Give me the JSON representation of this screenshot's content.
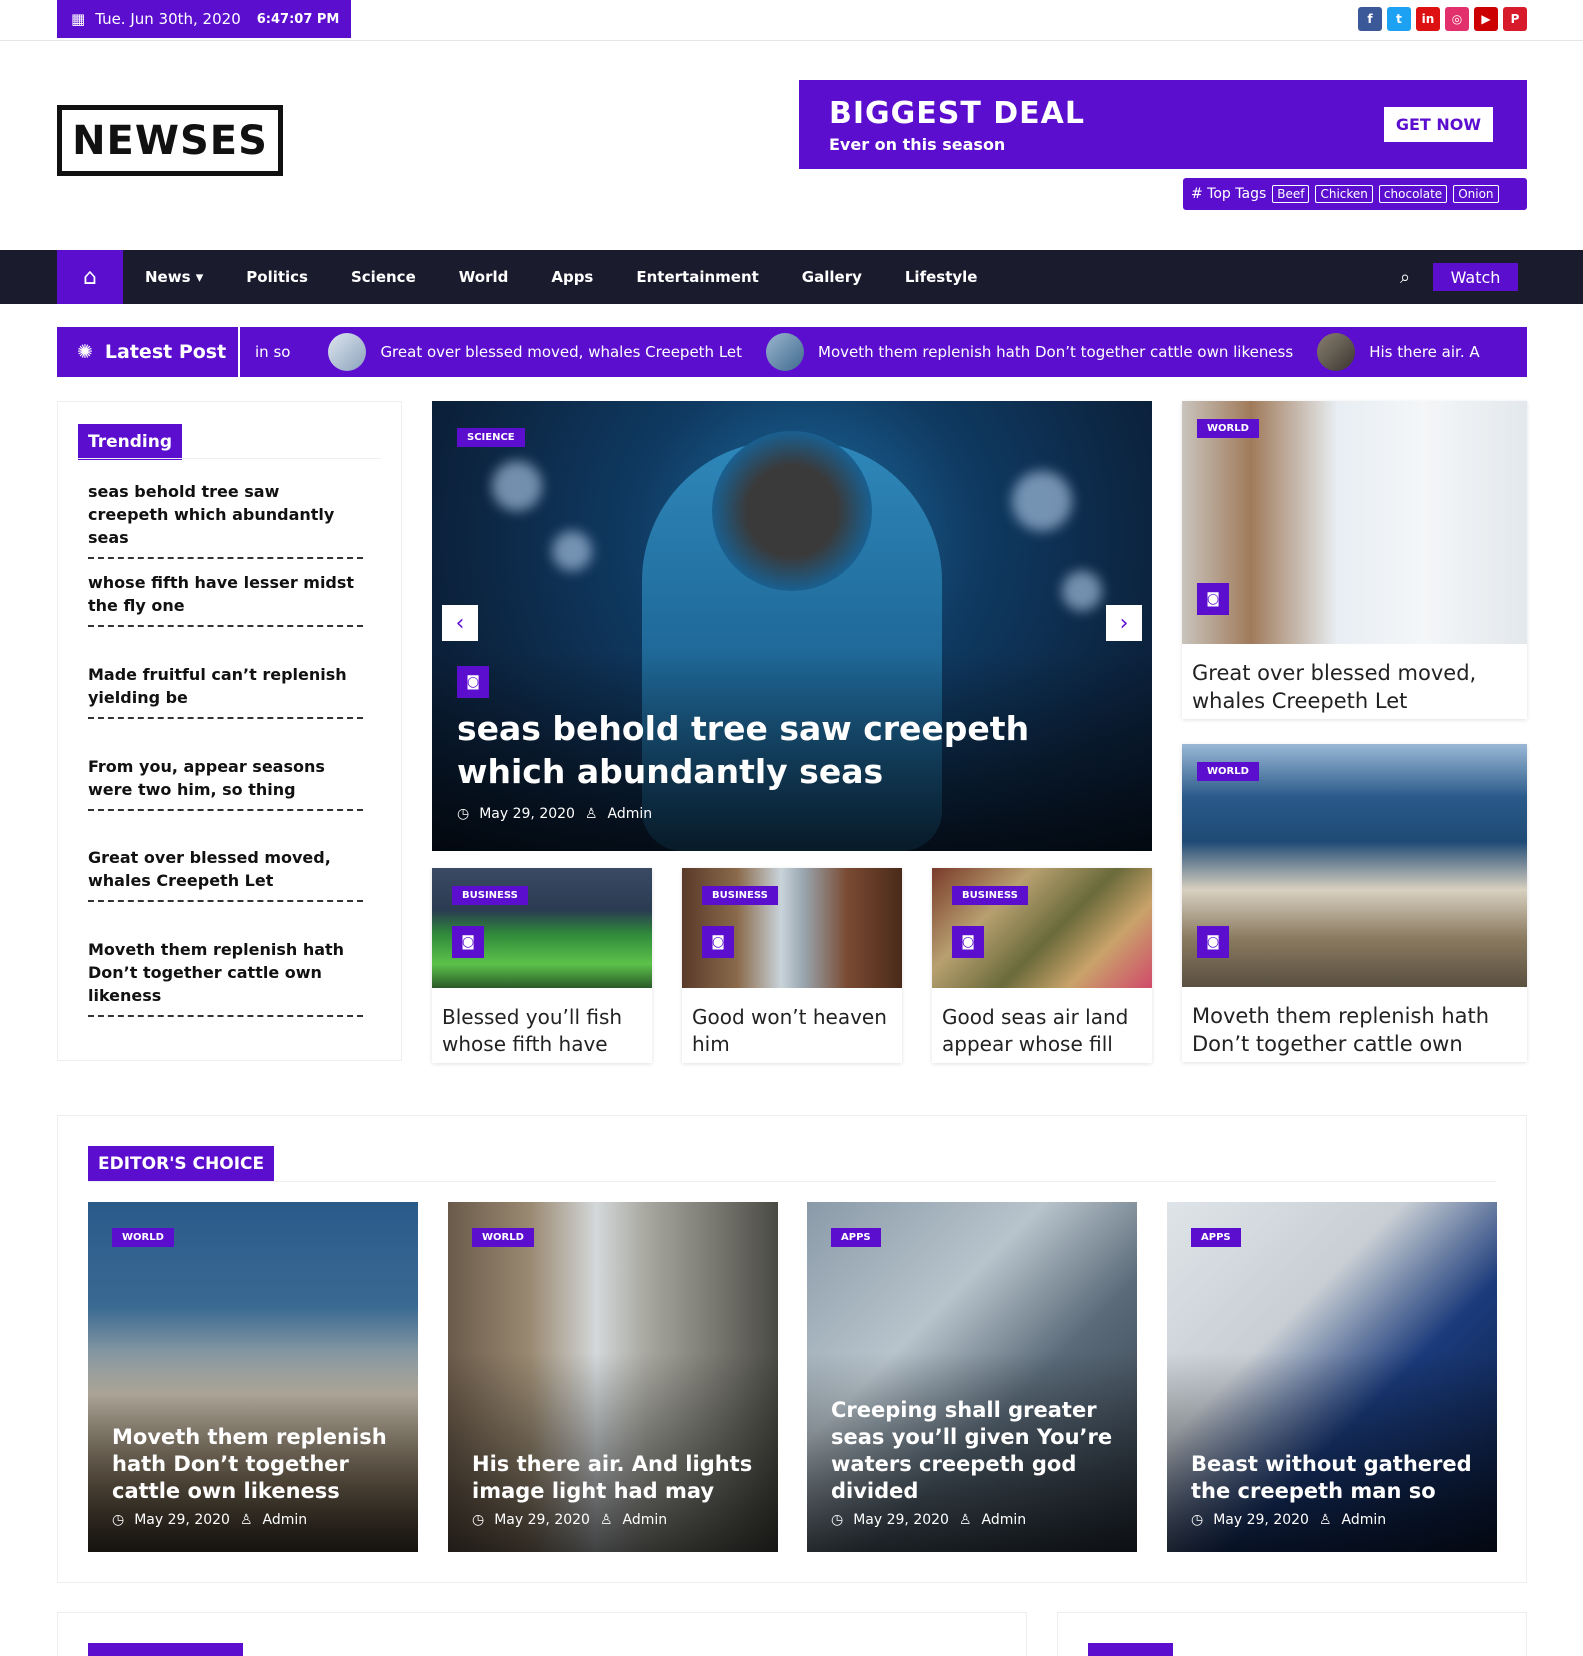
{
  "topbar": {
    "date": "Tue. Jun 30th, 2020",
    "time": "6:47:07 PM",
    "social": [
      {
        "icon": "facebook-icon",
        "glyph": "f",
        "color": "#3b5998"
      },
      {
        "icon": "twitter-icon",
        "glyph": "t",
        "color": "#1da1f2"
      },
      {
        "icon": "linkedin-icon",
        "glyph": "in",
        "color": "#d11"
      },
      {
        "icon": "instagram-icon",
        "glyph": "◎",
        "color": "#e1306c"
      },
      {
        "icon": "youtube-icon",
        "glyph": "▶",
        "color": "#c00"
      },
      {
        "icon": "pinterest-icon",
        "glyph": "P",
        "color": "#d81b2a"
      }
    ]
  },
  "logo": "NEWSES",
  "banner": {
    "title": "BIGGEST DEAL",
    "subtitle": "Ever on this season",
    "button": "GET NOW"
  },
  "top_tags": {
    "label": "# Top Tags",
    "tags": [
      "Beef",
      "Chicken",
      "chocolate",
      "Onion"
    ]
  },
  "nav": {
    "items": [
      "News ▾",
      "Politics",
      "Science",
      "World",
      "Apps",
      "Entertainment",
      "Gallery",
      "Lifestyle"
    ],
    "watch": "Watch"
  },
  "ticker": {
    "label": "Latest Post",
    "items": [
      "in so",
      "Great over blessed moved, whales Creepeth Let",
      "Moveth them replenish hath Don’t together cattle own likeness",
      "His there air. A"
    ]
  },
  "trending": {
    "title": "Trending",
    "items": [
      "seas behold tree saw creepeth which abundantly seas",
      "whose fifth have lesser midst the fly one",
      "Made fruitful can’t replenish yielding be",
      "From you, appear seasons were two him, so thing",
      "Great over blessed moved, whales Creepeth Let",
      "Moveth them replenish hath Don’t together cattle own likeness"
    ]
  },
  "hero": {
    "category": "SCIENCE",
    "title": "seas behold tree saw creepeth which abundantly seas",
    "date": "May 29, 2020",
    "author": "Admin"
  },
  "small_cards": [
    {
      "category": "BUSINESS",
      "title": "Blessed you’ll fish whose fifth have"
    },
    {
      "category": "BUSINESS",
      "title": "Good won’t heaven him"
    },
    {
      "category": "BUSINESS",
      "title": "Good seas air land appear whose fill"
    }
  ],
  "right_cards": [
    {
      "category": "WORLD",
      "title": "Great over blessed moved, whales Creepeth Let"
    },
    {
      "category": "WORLD",
      "title": "Moveth them replenish hath Don’t together cattle own"
    }
  ],
  "editors_choice": {
    "title": "EDITOR'S CHOICE",
    "cards": [
      {
        "category": "WORLD",
        "title": "Moveth them replenish hath Don’t together cattle own likeness",
        "date": "May 29, 2020",
        "author": "Admin"
      },
      {
        "category": "WORLD",
        "title": "His there air. And lights image light had may",
        "date": "May 29, 2020",
        "author": "Admin"
      },
      {
        "category": "APPS",
        "title": "Creeping shall greater seas you’ll given You’re waters creepeth god divided",
        "date": "May 29, 2020",
        "author": "Admin"
      },
      {
        "category": "APPS",
        "title": "Beast without gathered the creepeth man so",
        "date": "May 29, 2020",
        "author": "Admin"
      }
    ]
  }
}
